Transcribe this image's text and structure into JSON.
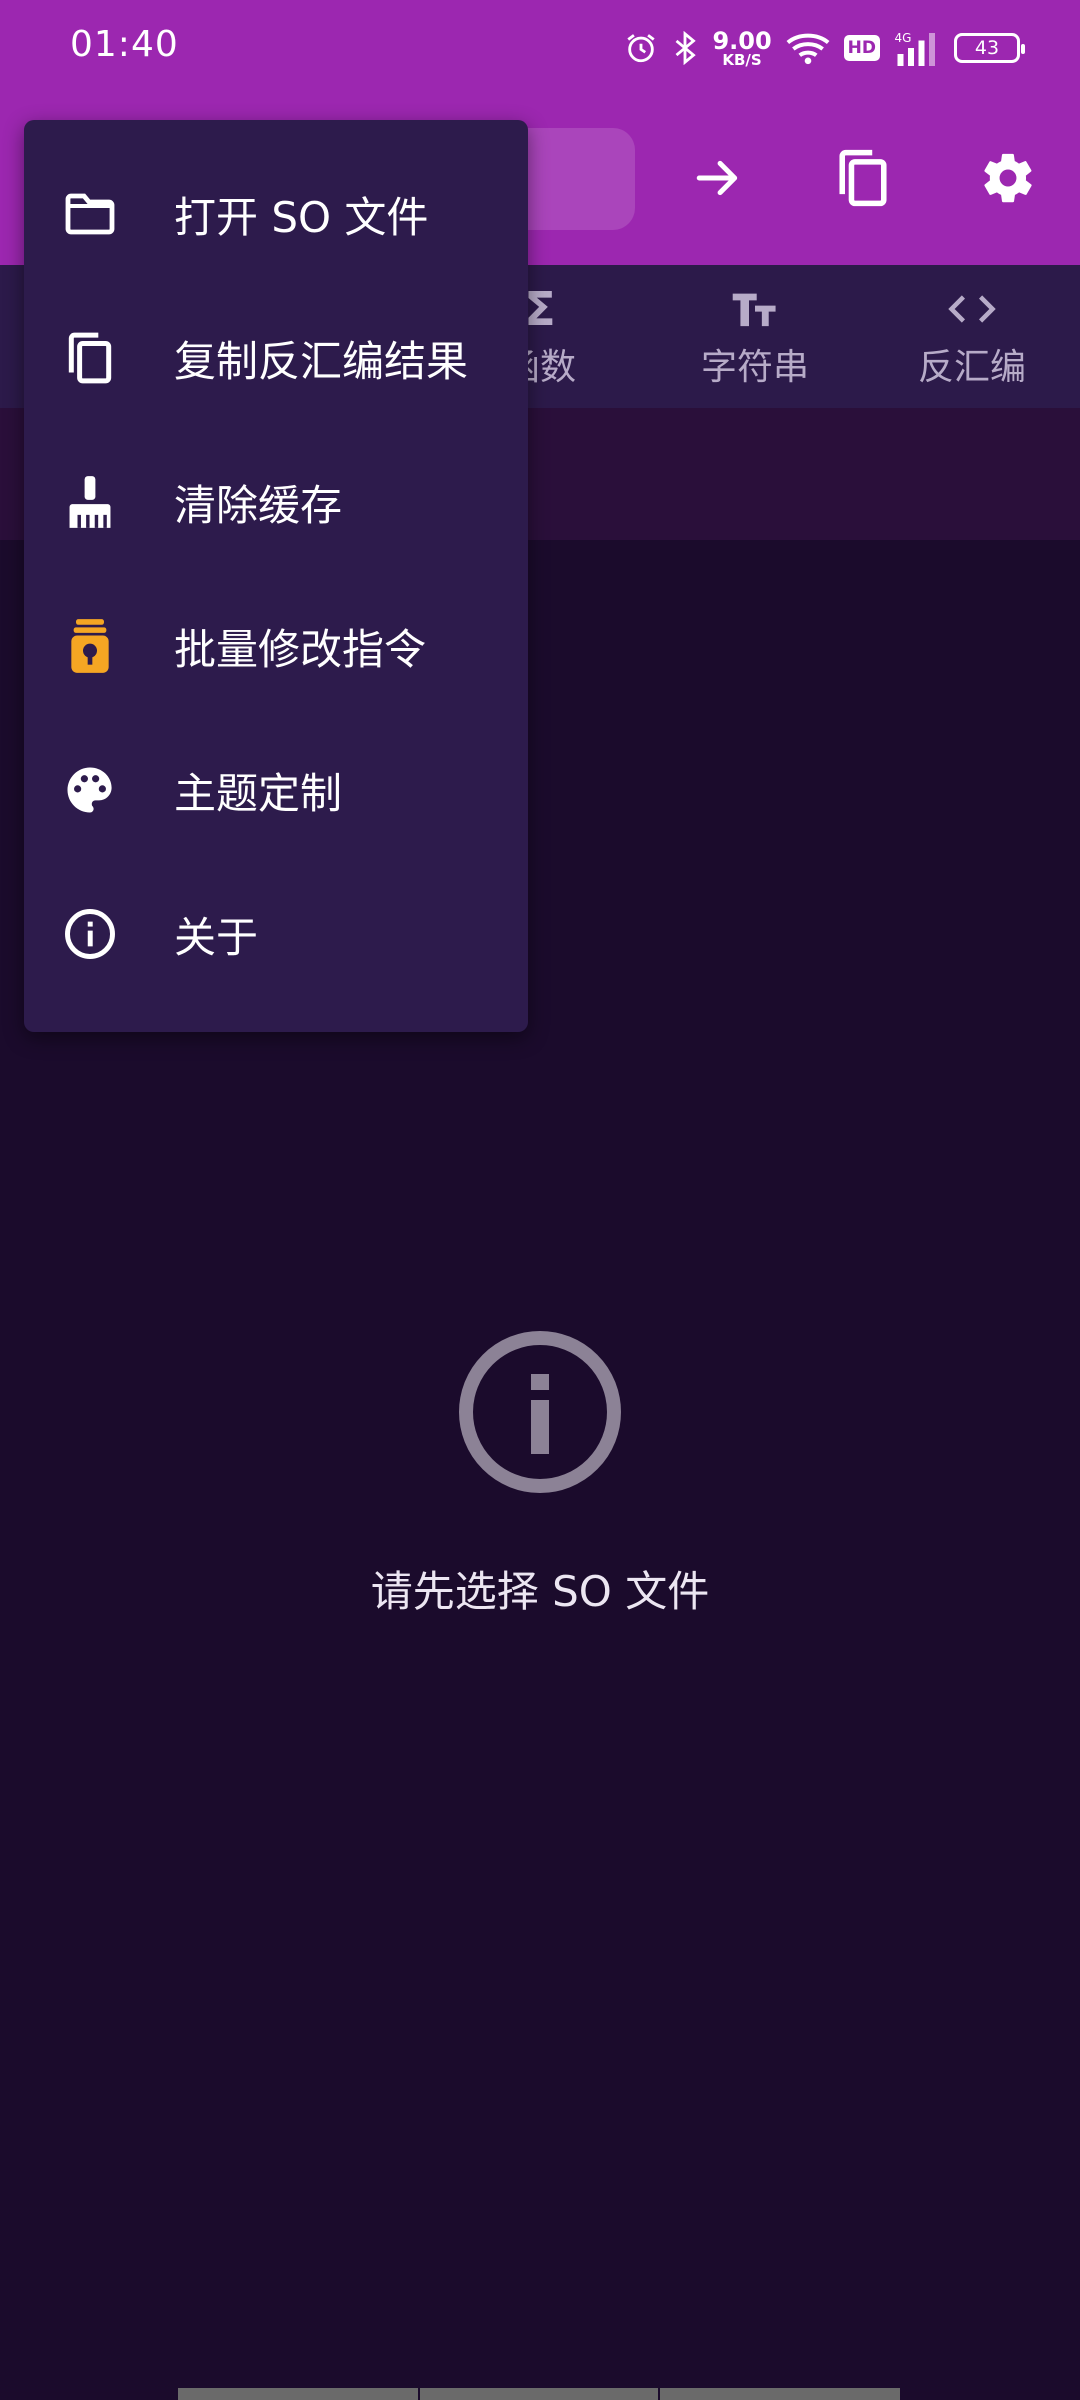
{
  "status_bar": {
    "time": "01:40",
    "net_speed_value": "9.00",
    "net_speed_unit": "KB/S",
    "hd_badge": "HD",
    "network_type": "4G",
    "battery_level": "43",
    "icons": [
      "alarm-icon",
      "bluetooth-icon",
      "wifi-icon",
      "hd-icon",
      "signal-icon",
      "battery-icon"
    ]
  },
  "app_bar": {
    "actions": [
      "arrow-forward-icon",
      "copy-icon",
      "settings-icon"
    ]
  },
  "tabs": [
    {
      "label": "函数",
      "icon": "sigma-icon"
    },
    {
      "label": "字符串",
      "icon": "text-size-icon"
    },
    {
      "label": "反汇编",
      "icon": "code-icon"
    }
  ],
  "menu": {
    "items": [
      {
        "label": "打开 SO 文件",
        "icon": "folder-icon"
      },
      {
        "label": "复制反汇编结果",
        "icon": "copy-icon"
      },
      {
        "label": "清除缓存",
        "icon": "broom-icon"
      },
      {
        "label": "批量修改指令",
        "icon": "jar-icon"
      },
      {
        "label": "主题定制",
        "icon": "palette-icon"
      },
      {
        "label": "关于",
        "icon": "info-icon"
      }
    ]
  },
  "empty_state": {
    "icon": "info-icon",
    "message": "请先选择 SO 文件"
  },
  "colors": {
    "app_bar": "#9c27b0",
    "tabs_bg": "#2c1a4a",
    "body_bg": "#1b0b2c",
    "menu_bg": "#2d1b4c",
    "accent_orange": "#f5a623"
  }
}
